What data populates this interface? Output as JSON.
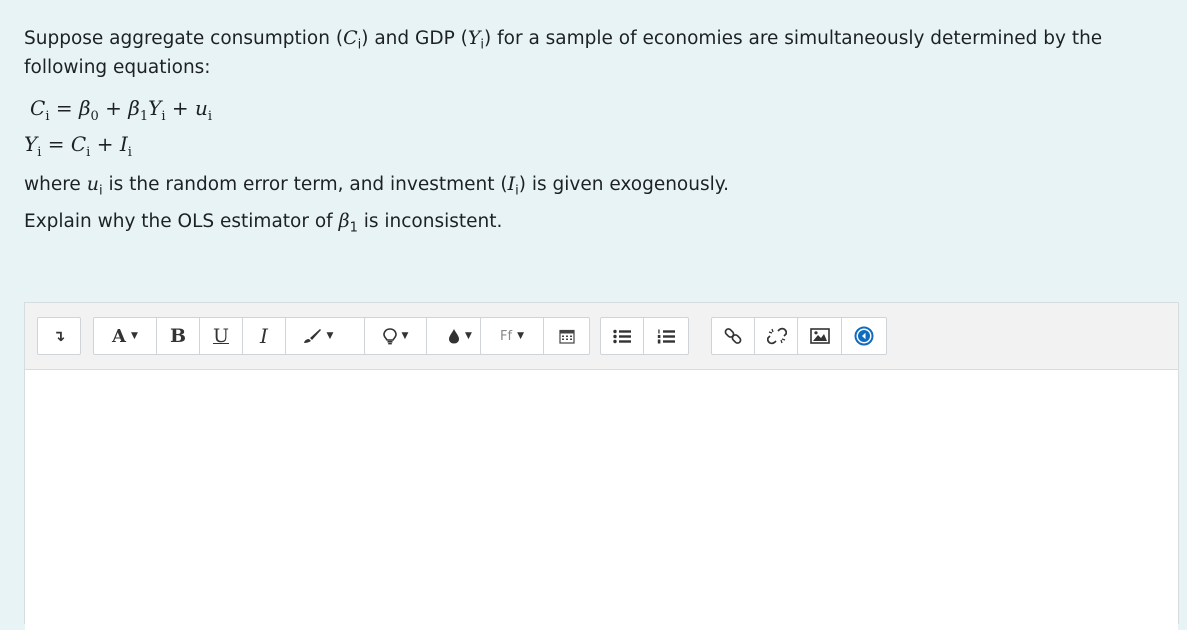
{
  "question": {
    "intro_pre": "Suppose aggregate consumption (",
    "intro_c": "C",
    "intro_mid": ") and GDP (",
    "intro_y": "Y",
    "intro_post": ") for a sample of economies are simultaneously determined by the following equations:",
    "sub_i": "i",
    "eq1": {
      "lhs": "C",
      "eq": " = ",
      "beta": "β",
      "b0": "0",
      "plus": " + ",
      "b1": "1",
      "y": "Y",
      "u": "u"
    },
    "eq2": {
      "lhs": "Y",
      "eq": " = ",
      "c": "C",
      "plus": " + ",
      "i": "I"
    },
    "where_pre": "where ",
    "where_u": "u",
    "where_mid": " is the random error term, and investment (",
    "where_i": "I",
    "where_post": ") is given exogenously.",
    "explain_pre": "Explain why the OLS estimator of ",
    "explain_beta": "β",
    "explain_sub": "1",
    "explain_post": " is inconsistent."
  },
  "toolbar": {
    "collapse_icon": "↴",
    "font_label": "A",
    "bold_label": "B",
    "underline_label": "U",
    "italic_label": "I",
    "font_family_label": "Ff",
    "icons": {
      "brush": "brush-icon",
      "bulb": "lightbulb-icon",
      "drop": "drop-icon",
      "calendar": "calendar-icon",
      "bullet_list": "bullet-list-icon",
      "numbered_list": "numbered-list-icon",
      "link": "link-icon",
      "unlink": "unlink-icon",
      "image": "image-icon",
      "media": "media-icon"
    },
    "accent_color": "#0f6cbf"
  }
}
